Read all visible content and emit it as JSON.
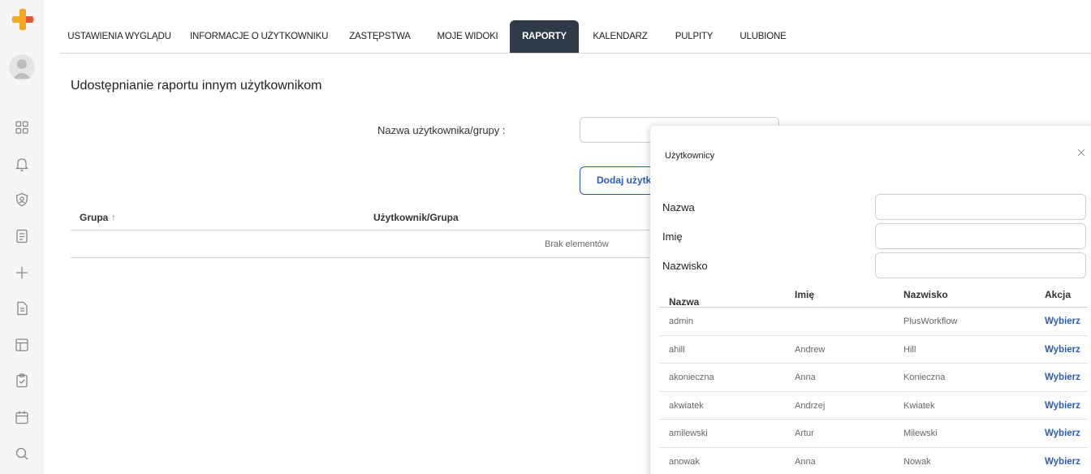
{
  "sidebar": {
    "icons": [
      "dashboard-icon",
      "bell-icon",
      "shield-icon",
      "report-icon",
      "plus-icon",
      "document-icon",
      "layout-icon",
      "clipboard-check-icon",
      "calendar-icon",
      "search-icon"
    ]
  },
  "tabs": [
    {
      "label": "USTAWIENIA WYGLĄDU"
    },
    {
      "label": "INFORMACJE O UŻYTKOWNIKU"
    },
    {
      "label": "ZASTĘPSTWA"
    },
    {
      "label": "MOJE WIDOKI"
    },
    {
      "label": "RAPORTY",
      "active": true
    },
    {
      "label": "KALENDARZ"
    },
    {
      "label": "PULPITY"
    },
    {
      "label": "ULUBIONE"
    }
  ],
  "page": {
    "title": "Udostępnianie raportu innym użytkownikom",
    "field_label": "Nazwa użytkownika/grupy :",
    "field_value": "",
    "add_button": "Dodaj użytkow",
    "table": {
      "col_group": "Grupa",
      "col_user": "Użytkownik/Grupa",
      "empty": "Brak elementów"
    }
  },
  "popup": {
    "title": "Użytkownicy",
    "filters": {
      "name_label": "Nazwa",
      "first_label": "Imię",
      "last_label": "Nazwisko"
    },
    "columns": {
      "name": "Nazwa",
      "first": "Imię",
      "last": "Nazwisko",
      "action": "Akcja"
    },
    "rows": [
      {
        "name": "admin",
        "first": "",
        "last": "PlusWorkflow",
        "action": "Wybierz"
      },
      {
        "name": "ahill",
        "first": "Andrew",
        "last": "Hill",
        "action": "Wybierz"
      },
      {
        "name": "akonieczna",
        "first": "Anna",
        "last": "Konieczna",
        "action": "Wybierz"
      },
      {
        "name": "akwiatek",
        "first": "Andrzej",
        "last": "Kwiatek",
        "action": "Wybierz"
      },
      {
        "name": "amilewski",
        "first": "Artur",
        "last": "Milewski",
        "action": "Wybierz"
      },
      {
        "name": "anowak",
        "first": "Anna",
        "last": "Nowak",
        "action": "Wybierz"
      }
    ]
  },
  "colors": {
    "accent": "#2a5db0",
    "active_tab": "#2e3a47",
    "logo": "#f5a623"
  }
}
